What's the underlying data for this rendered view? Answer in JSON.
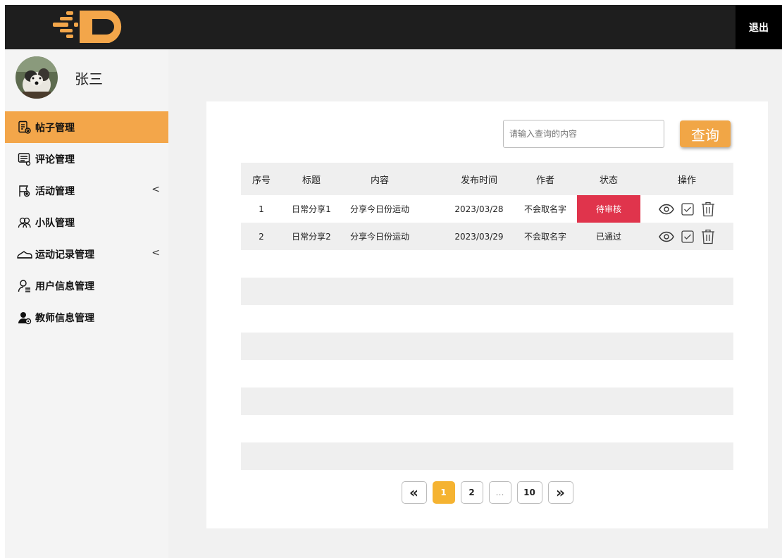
{
  "header": {
    "logout_label": "退出",
    "brand_color": "#f3a64a"
  },
  "user": {
    "name": "张三"
  },
  "sidebar": {
    "items": [
      {
        "label": "帖子管理",
        "icon": "document-gear-icon",
        "active": true,
        "has_chevron": false
      },
      {
        "label": "评论管理",
        "icon": "comment-gear-icon",
        "active": false,
        "has_chevron": false
      },
      {
        "label": "活动管理",
        "icon": "flag-gear-icon",
        "active": false,
        "has_chevron": true
      },
      {
        "label": "小队管理",
        "icon": "team-icon",
        "active": false,
        "has_chevron": false
      },
      {
        "label": "运动记录管理",
        "icon": "shoe-icon",
        "active": false,
        "has_chevron": true
      },
      {
        "label": "用户信息管理",
        "icon": "user-list-icon",
        "active": false,
        "has_chevron": false
      },
      {
        "label": "教师信息管理",
        "icon": "teacher-gear-icon",
        "active": false,
        "has_chevron": false
      }
    ],
    "chevron": "<"
  },
  "search": {
    "placeholder": "请输入查询的内容",
    "button_label": "查询"
  },
  "table": {
    "columns": [
      "序号",
      "标题",
      "内容",
      "发布时间",
      "作者",
      "状态",
      "操作"
    ],
    "rows": [
      {
        "index": "1",
        "title": "日常分享1",
        "content": "分享今日份运动",
        "time": "2023/03/28",
        "author": "不会取名字",
        "status": "待审核",
        "status_color": "#e0344c"
      },
      {
        "index": "2",
        "title": "日常分享2",
        "content": "分享今日份运动",
        "time": "2023/03/29",
        "author": "不会取名字",
        "status": "已通过",
        "status_color": ""
      }
    ],
    "empty_rows": 8
  },
  "pagination": {
    "first": "«",
    "pages": [
      "1",
      "2",
      "…",
      "10"
    ],
    "current": "1",
    "last": "»"
  }
}
